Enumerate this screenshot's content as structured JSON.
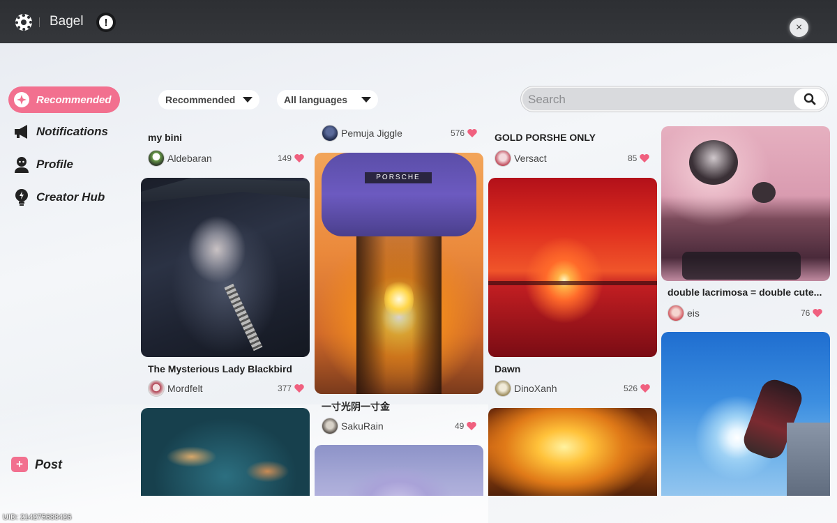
{
  "app": {
    "title": "Bagel"
  },
  "topbar": {
    "close_label": "×",
    "alert_label": "!"
  },
  "sidebar": {
    "items": [
      {
        "label": "Recommended",
        "active": true
      },
      {
        "label": "Notifications",
        "active": false
      },
      {
        "label": "Profile",
        "active": false
      },
      {
        "label": "Creator Hub",
        "active": false
      }
    ],
    "post_label": "Post",
    "post_icon": "+"
  },
  "uid_text": "UID: 214275688426",
  "filters": {
    "sort": "Recommended",
    "language": "All languages"
  },
  "search": {
    "placeholder": "Search",
    "value": ""
  },
  "feed": {
    "columns": [
      [
        {
          "title": "my bini",
          "author": "Aldebaran",
          "likes": "149"
        },
        {
          "title": "The Mysterious Lady Blackbird",
          "author": "Mordfelt",
          "likes": "377"
        },
        {
          "title": "",
          "author": "",
          "likes": ""
        }
      ],
      [
        {
          "title": "",
          "author": "Pemuja Jiggle",
          "likes": "576"
        },
        {
          "title": "一寸光阴一寸金",
          "author": "SakuRain",
          "likes": "49"
        },
        {
          "title": "",
          "author": "",
          "likes": ""
        }
      ],
      [
        {
          "title": "GOLD PORSHE ONLY",
          "author": "Versact",
          "likes": "85"
        },
        {
          "title": "Dawn",
          "author": "DinoXanh",
          "likes": "526"
        },
        {
          "title": "",
          "author": "",
          "likes": ""
        }
      ],
      [
        {
          "title": "double lacrimosa = double cute...",
          "author": "eis",
          "likes": "76"
        },
        {
          "title": "",
          "author": "",
          "likes": ""
        }
      ]
    ],
    "image_text": {
      "porsche_jacket": "PORSCHE"
    }
  },
  "colors": {
    "accent": "#f2708f",
    "topbar": "#2d2f33",
    "heart": "#f0607f"
  }
}
